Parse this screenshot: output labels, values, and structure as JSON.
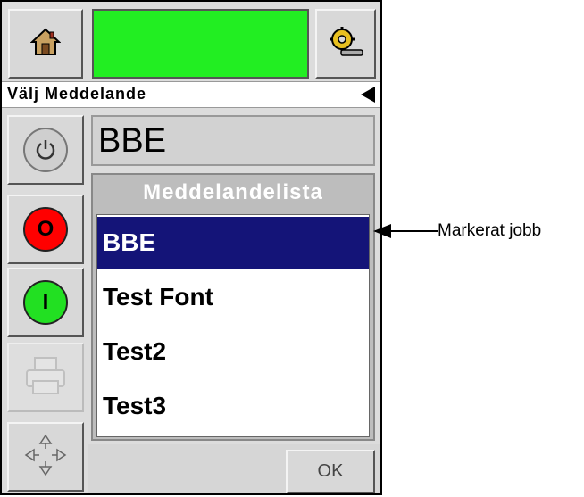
{
  "toolbar": {
    "home_icon": "home-icon",
    "settings_icon": "gear-wrench-icon",
    "status_color": "#22ee22"
  },
  "title_bar": {
    "title": "Välj Meddelande",
    "back_icon": "back-arrow-icon"
  },
  "sidebar": {
    "power_icon": "power-icon",
    "stop_label": "O",
    "start_label": "I",
    "print_icon": "printer-icon",
    "nav_icon": "direction-pad-icon"
  },
  "message_field": {
    "value": "BBE"
  },
  "message_list": {
    "header": "Meddelandelista",
    "items": [
      "BBE",
      "Test Font",
      "Test2",
      "Test3"
    ],
    "selected_index": 0
  },
  "footer": {
    "ok_label": "OK"
  },
  "annotation": {
    "label": "Markerat jobb"
  },
  "colors": {
    "selected_bg": "#141478",
    "stop": "#ff0000",
    "start": "#22e022"
  }
}
